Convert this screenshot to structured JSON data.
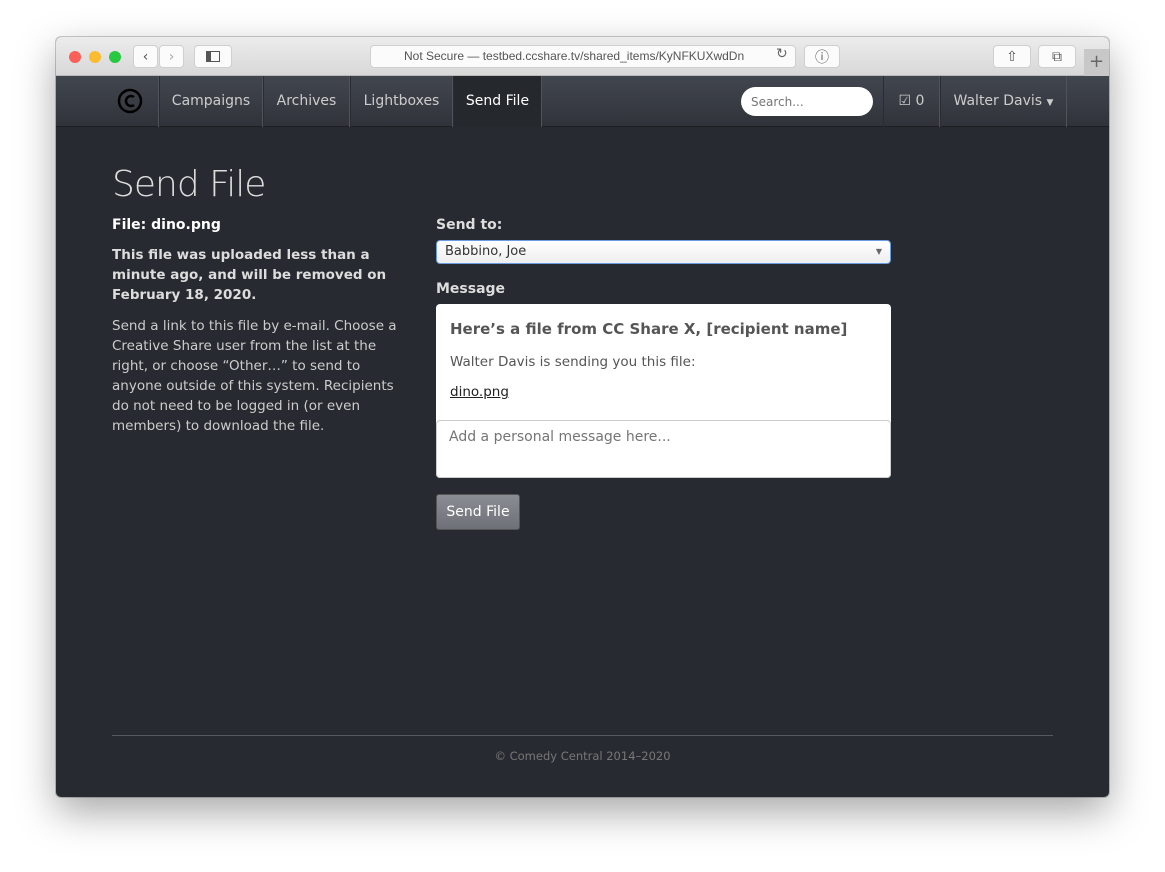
{
  "browser": {
    "url": "Not Secure — testbed.ccshare.tv/shared_items/KyNFKUXwdDn"
  },
  "nav": {
    "items": [
      {
        "label": "Campaigns"
      },
      {
        "label": "Archives"
      },
      {
        "label": "Lightboxes"
      },
      {
        "label": "Send File",
        "active": true
      }
    ],
    "search_placeholder": "Search...",
    "check_count": "0",
    "user": "Walter Davis"
  },
  "page": {
    "title": "Send File",
    "file_label": "File: dino.png",
    "notice": "This file was uploaded less than a minute ago, and will be removed on February 18, 2020.",
    "description": "Send a link to this file by e-mail. Choose a Creative Share user from the list at the right, or choose “Other…” to send to anyone outside of this system. Recipients do not need to be logged in (or even members) to download the file."
  },
  "form": {
    "send_to_label": "Send to:",
    "send_to_value": "Babbino, Joe",
    "message_label": "Message",
    "preview_heading": "Here’s a file from CC Share X, [recipient name]",
    "preview_line": "Walter Davis is sending you this file:",
    "preview_link": "dino.png",
    "personal_placeholder": "Add a personal message here...",
    "submit": "Send File"
  },
  "footer": {
    "text": "© Comedy Central 2014–2020"
  }
}
